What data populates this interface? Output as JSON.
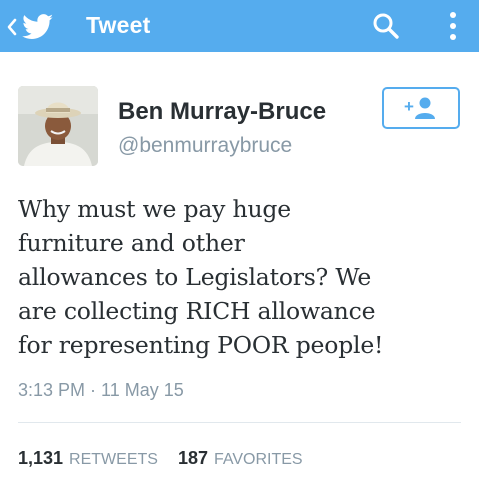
{
  "header": {
    "title": "Tweet",
    "back_icon": "chevron-left-icon",
    "logo_icon": "twitter-bird-icon",
    "search_icon": "search-icon",
    "more_icon": "more-vertical-icon",
    "background": "#55acee"
  },
  "user": {
    "name": "Ben Murray-Bruce",
    "handle": "@benmurraybruce"
  },
  "follow_button": {
    "icon": "add-user-icon",
    "accent": "#55acee"
  },
  "tweet": {
    "lines": [
      "Why must we pay huge",
      "furniture and other",
      "allowances to Legislators? We",
      "are collecting RICH allowance",
      "for representing POOR people!"
    ],
    "timestamp": "3:13 PM · 11 May 15"
  },
  "stats": {
    "retweets_count": "1,131",
    "retweets_label": "RETWEETS",
    "favorites_count": "187",
    "favorites_label": "FAVORITES"
  }
}
